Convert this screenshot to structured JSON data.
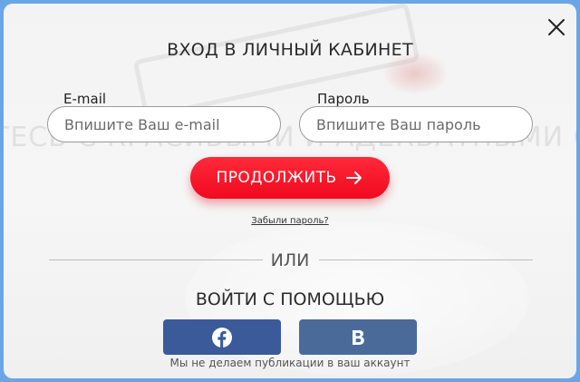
{
  "modal": {
    "title": "ВХОД В ЛИЧНЫЙ КАБИНЕТ",
    "close_icon": "close-icon"
  },
  "form": {
    "email": {
      "label": "E-mail",
      "placeholder": "Впишите Ваш e-mail",
      "value": ""
    },
    "password": {
      "label": "Пароль",
      "placeholder": "Впишите Ваш пароль",
      "value": ""
    },
    "continue_label": "ПРОДОЛЖИТЬ",
    "continue_icon": "arrow-right-icon",
    "forgot_label": "Забыли пароль?"
  },
  "divider": {
    "text": "ИЛИ"
  },
  "social": {
    "title": "ВОЙТИ С ПОМОЩЬЮ",
    "facebook_icon": "facebook-icon",
    "vk_icon": "vk-icon",
    "disclaimer": "Мы не делаем публикации в ваш аккаунт"
  },
  "background": {
    "slogan": "ТЕСЬ С КРАСИВЫМИ И АДЕКВАТНЫМИ С"
  },
  "colors": {
    "accent": "#f0091f",
    "facebook": "#3b5a9a",
    "vk": "#4a6b9a",
    "page_bg": "#6aa6e6"
  }
}
